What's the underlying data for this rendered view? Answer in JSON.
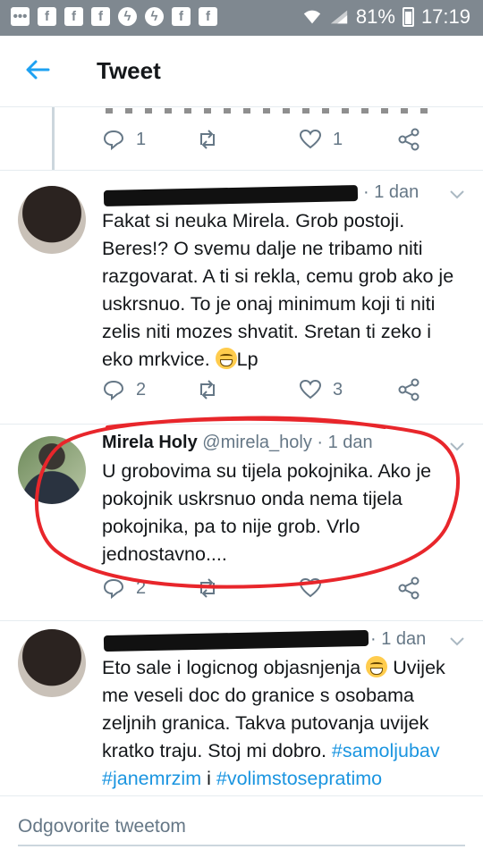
{
  "status_bar": {
    "battery": "81%",
    "time": "17:19",
    "icons": [
      "chat-bubble-icon",
      "facebook-icon",
      "facebook-icon",
      "facebook-icon",
      "messenger-icon",
      "messenger-icon",
      "facebook-icon",
      "facebook-icon"
    ]
  },
  "header": {
    "title": "Tweet"
  },
  "top_actions": {
    "replies": "1",
    "likes": "1"
  },
  "tweets": [
    {
      "time": "· 1 dan",
      "text": "Fakat si neuka Mirela. Grob postoji. Beres!? O svemu dalje ne tribamo niti razgovarat. A ti si rekla, cemu grob ako je uskrsnuo. To je onaj minimum koji ti niti zelis niti mozes shvatit. Sretan ti zeko i eko mrkvice.",
      "text_end": "Lp",
      "replies": "2",
      "likes": "3"
    },
    {
      "name": "Mirela Holy",
      "handle": "@mirela_holy",
      "time": "· 1 dan",
      "text": "U grobovima su tijela pokojnika. Ako je pokojnik uskrsnuo onda nema tijela pokojnika, pa to nije grob. Vrlo jednostavno....",
      "replies": "2"
    },
    {
      "time": "· 1 dan",
      "text_a": "Eto sale i logicnog objasnjenja",
      "text_b": "Uvijek me veseli doc do granice s osobama zeljnih granica. Takva putovanja uvijek kratko traju. Stoj mi dobro.",
      "tag1": "#samoljubav",
      "tag2": "#janemrzim",
      "conj": "i",
      "tag3": "#volimstosepratimo"
    }
  ],
  "reply_bar": {
    "placeholder": "Odgovorite tweetom"
  },
  "colors": {
    "accent": "#1b95e0",
    "annotation": "#e8262b",
    "status_bar": "#7f8890"
  }
}
